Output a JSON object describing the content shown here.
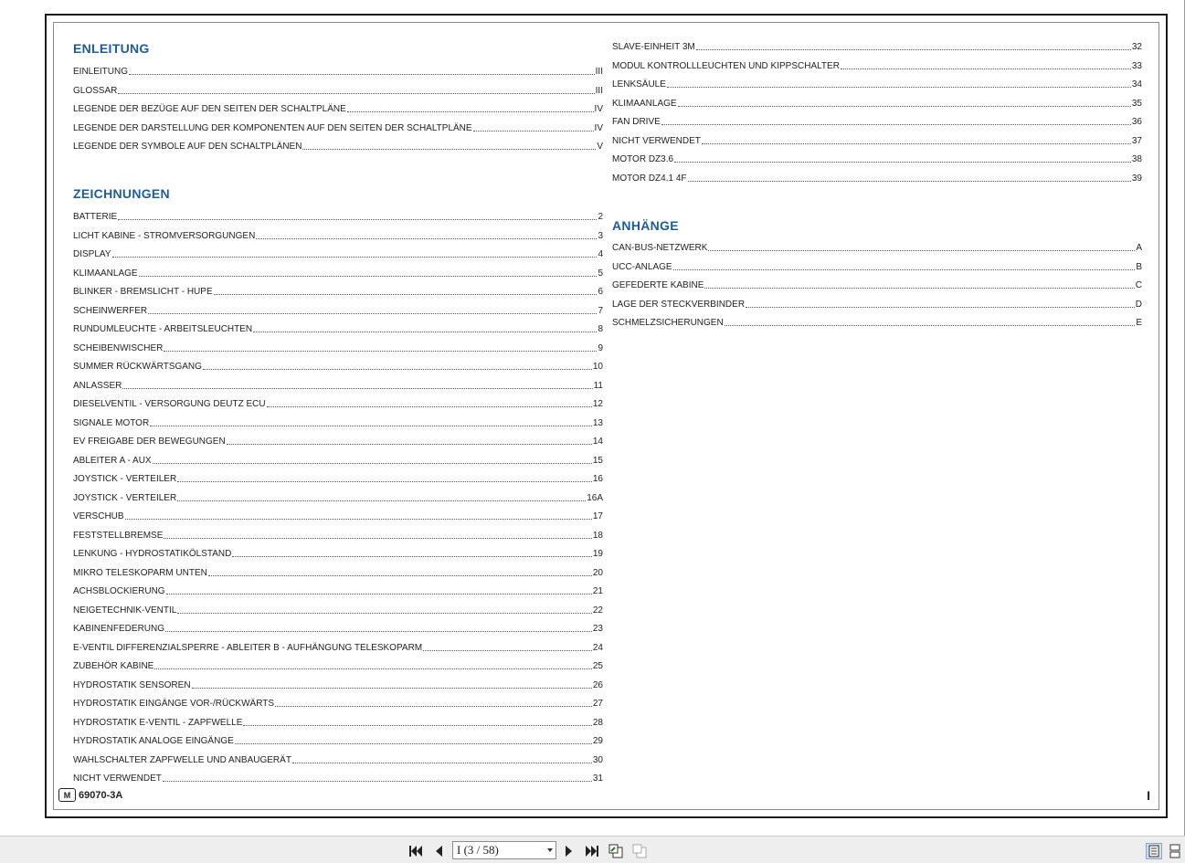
{
  "left_column": {
    "sections": [
      {
        "title": "ENLEITUNG",
        "entries": [
          {
            "label": "EINLEITUNG",
            "page": "III"
          },
          {
            "label": "GLOSSAR",
            "page": "III"
          },
          {
            "label": "LEGENDE DER BEZÜGE AUF DEN SEITEN DER SCHALTPLÄNE",
            "page": "IV"
          },
          {
            "label": "LEGENDE DER DARSTELLUNG DER KOMPONENTEN AUF DEN SEITEN DER SCHALTPLÄNE",
            "page": "IV"
          },
          {
            "label": "LEGENDE DER SYMBOLE AUF DEN SCHALTPLÄNEN",
            "page": "V"
          }
        ]
      },
      {
        "title": "ZEICHNUNGEN",
        "entries": [
          {
            "label": "BATTERIE",
            "page": "2"
          },
          {
            "label": "LICHT KABINE - STROMVERSORGUNGEN",
            "page": "3"
          },
          {
            "label": "DISPLAY",
            "page": "4"
          },
          {
            "label": "KLIMAANLAGE",
            "page": "5"
          },
          {
            "label": "BLINKER - BREMSLICHT - HUPE",
            "page": "6"
          },
          {
            "label": "SCHEINWERFER",
            "page": "7"
          },
          {
            "label": "RUNDUMLEUCHTE - ARBEITSLEUCHTEN",
            "page": "8"
          },
          {
            "label": "SCHEIBENWISCHER",
            "page": "9"
          },
          {
            "label": "SUMMER RÜCKWÄRTSGANG",
            "page": "10"
          },
          {
            "label": "ANLASSER",
            "page": "11"
          },
          {
            "label": "DIESELVENTIL - VERSORGUNG DEUTZ ECU",
            "page": "12"
          },
          {
            "label": "SIGNALE MOTOR",
            "page": "13"
          },
          {
            "label": "EV FREIGABE DER BEWEGUNGEN",
            "page": "14"
          },
          {
            "label": "ABLEITER A - AUX",
            "page": "15"
          },
          {
            "label": "JOYSTICK - VERTEILER",
            "page": "16"
          },
          {
            "label": "JOYSTICK - VERTEILER",
            "page": "16A"
          },
          {
            "label": "VERSCHUB",
            "page": "17"
          },
          {
            "label": "FESTSTELLBREMSE",
            "page": "18"
          },
          {
            "label": "LENKUNG - HYDROSTATIKÖLSTAND",
            "page": "19"
          },
          {
            "label": "MIKRO TELESKOPARM UNTEN",
            "page": "20"
          },
          {
            "label": "ACHSBLOCKIERUNG",
            "page": "21"
          },
          {
            "label": "NEIGETECHNIK-VENTIL",
            "page": "22"
          },
          {
            "label": "KABINENFEDERUNG",
            "page": "23"
          },
          {
            "label": "E-VENTIL DIFFERENZIALSPERRE - ABLEITER B - AUFHÄNGUNG TELESKOPARM",
            "page": "24"
          },
          {
            "label": "ZUBEHÖR KABINE",
            "page": "25"
          },
          {
            "label": "HYDROSTATIK SENSOREN",
            "page": "26"
          },
          {
            "label": "HYDROSTATIK EINGÄNGE VOR-/RÜCKWÄRTS",
            "page": "27"
          },
          {
            "label": "HYDROSTATIK E-VENTIL - ZAPFWELLE",
            "page": "28"
          },
          {
            "label": "HYDROSTATIK ANALOGE EINGÄNGE",
            "page": "29"
          },
          {
            "label": "WAHLSCHALTER ZAPFWELLE UND ANBAUGERÄT",
            "page": "30"
          },
          {
            "label": "NICHT VERWENDET",
            "page": "31"
          }
        ]
      }
    ]
  },
  "right_column": {
    "sections": [
      {
        "title": "",
        "entries": [
          {
            "label": "SLAVE-EINHEIT 3M",
            "page": "32"
          },
          {
            "label": "MODUL KONTROLLLEUCHTEN UND KIPPSCHALTER",
            "page": "33"
          },
          {
            "label": "LENKSÄULE",
            "page": "34"
          },
          {
            "label": "KLIMAANLAGE",
            "page": "35"
          },
          {
            "label": "FAN DRIVE",
            "page": "36"
          },
          {
            "label": "NICHT VERWENDET",
            "page": "37"
          },
          {
            "label": "MOTOR DZ3.6",
            "page": "38"
          },
          {
            "label": "MOTOR DZ4.1 4F",
            "page": "39"
          }
        ]
      },
      {
        "title": "ANHÄNGE",
        "entries": [
          {
            "label": "CAN-BUS-NETZWERK",
            "page": "A"
          },
          {
            "label": "UCC-ANLAGE",
            "page": "B"
          },
          {
            "label": "GEFEDERTE KABINE",
            "page": "C"
          },
          {
            "label": "LAGE DER STECKVERBINDER",
            "page": "D"
          },
          {
            "label": "SCHMELZSICHERUNGEN",
            "page": "E"
          }
        ]
      }
    ]
  },
  "footer": {
    "logo_text": "M",
    "doc_code": "69070-3A",
    "page_roman": "I"
  },
  "toolbar": {
    "page_indicator": "I (3 / 58)",
    "icons": [
      "first-page-icon",
      "prev-page-icon",
      "next-page-icon",
      "last-page-icon",
      "go-back-view-icon",
      "go-forward-view-icon",
      "single-page-view-icon",
      "continuous-view-icon"
    ]
  }
}
